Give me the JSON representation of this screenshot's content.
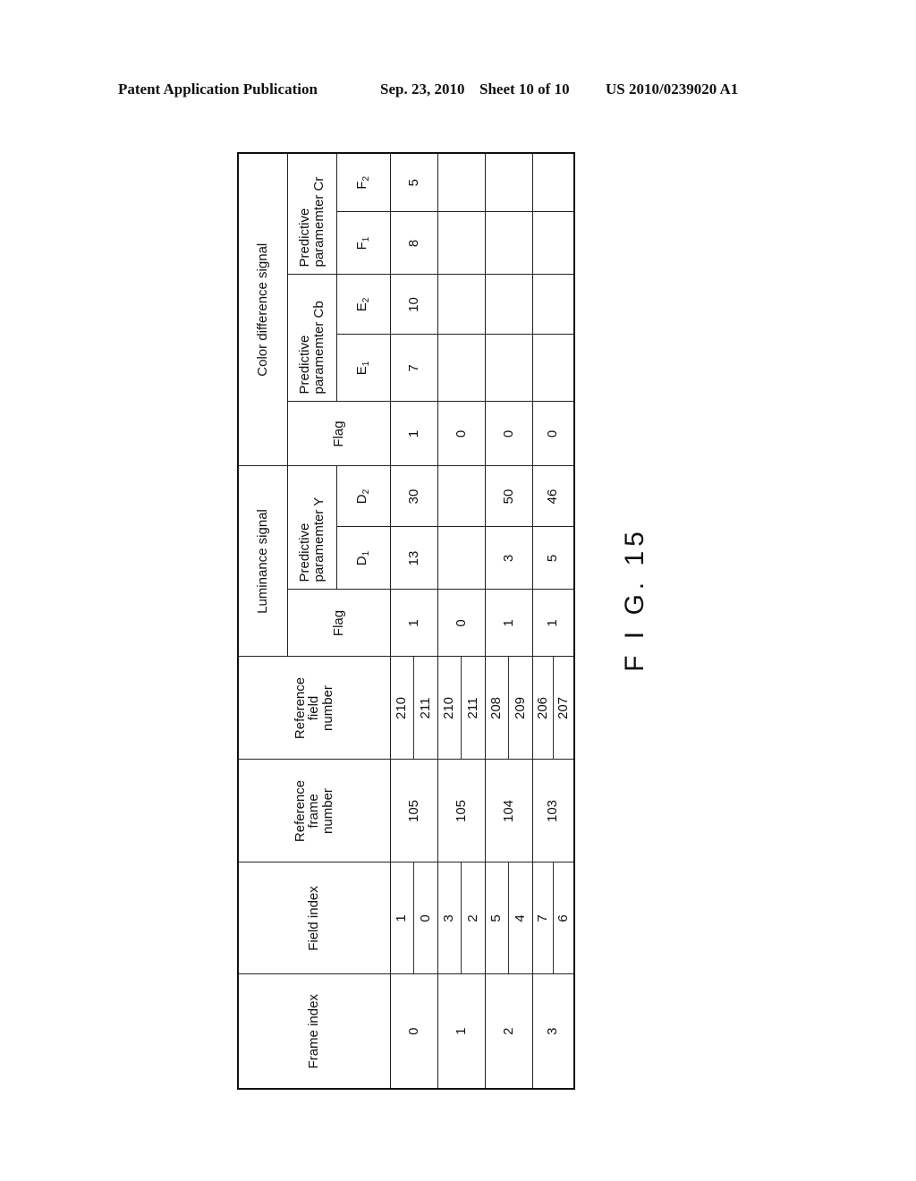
{
  "header": {
    "publication": "Patent Application Publication",
    "date": "Sep. 23, 2010",
    "sheet": "Sheet 10 of 10",
    "number": "US 2010/0239020 A1"
  },
  "figure_label": "F I G. 15",
  "table": {
    "headers": {
      "frame_index": "Frame index",
      "field_index": "Field index",
      "ref_frame": "Reference frame number",
      "ref_field": "Reference field number",
      "luminance": "Luminance signal",
      "color_diff": "Color difference signal",
      "flag": "Flag",
      "pred_y": "Predictive paramemter  Y",
      "pred_cb": "Predictive paramemter  Cb",
      "pred_cr": "Predictive paramemter  Cr",
      "d1": "D",
      "d1_sub": "1",
      "d2": "D",
      "d2_sub": "2",
      "e1": "E",
      "e1_sub": "1",
      "e2": "E",
      "e2_sub": "2",
      "f1": "F",
      "f1_sub": "1",
      "f2": "F",
      "f2_sub": "2"
    },
    "rows": [
      {
        "frame_index": "0",
        "field_index": [
          "1",
          "0"
        ],
        "ref_frame": "105",
        "ref_field": [
          "210",
          "211"
        ],
        "y_flag": "1",
        "d1": "13",
        "d2": "30",
        "c_flag": "1",
        "e1": "7",
        "e2": "10",
        "f1": "8",
        "f2": "5"
      },
      {
        "frame_index": "1",
        "field_index": [
          "3",
          "2"
        ],
        "ref_frame": "105",
        "ref_field": [
          "210",
          "211"
        ],
        "y_flag": "0",
        "d1": "",
        "d2": "",
        "c_flag": "0",
        "e1": "",
        "e2": "",
        "f1": "",
        "f2": ""
      },
      {
        "frame_index": "2",
        "field_index": [
          "5",
          "4"
        ],
        "ref_frame": "104",
        "ref_field": [
          "208",
          "209"
        ],
        "y_flag": "1",
        "d1": "3",
        "d2": "50",
        "c_flag": "0",
        "e1": "",
        "e2": "",
        "f1": "",
        "f2": ""
      },
      {
        "frame_index": "3",
        "field_index": [
          "7",
          "6"
        ],
        "ref_frame": "103",
        "ref_field": [
          "206",
          "207"
        ],
        "y_flag": "1",
        "d1": "5",
        "d2": "46",
        "c_flag": "0",
        "e1": "",
        "e2": "",
        "f1": "",
        "f2": ""
      }
    ]
  }
}
